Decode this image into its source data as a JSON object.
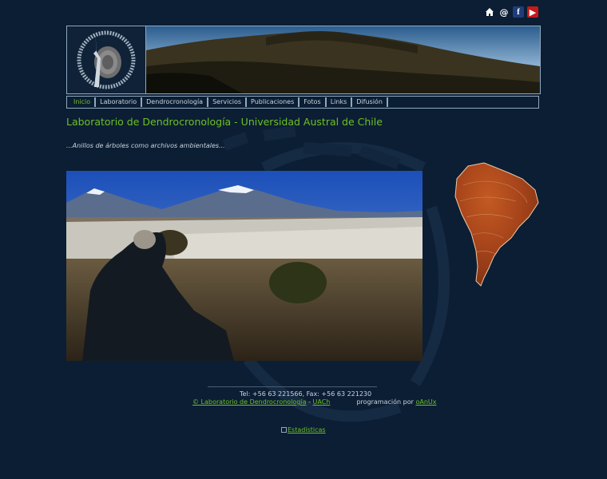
{
  "top_icons": [
    "home-icon",
    "at-icon",
    "facebook-icon",
    "youtube-icon"
  ],
  "logo": {
    "ring_text": "LABORATORIO DE DENDROCRONOLOGIA · UNIVERSIDAD AUSTRAL DE CHILE"
  },
  "nav": {
    "items": [
      {
        "label": "Inicio",
        "active": true
      },
      {
        "label": "Laboratorio",
        "active": false
      },
      {
        "label": "Dendrocronología",
        "active": false
      },
      {
        "label": "Servicios",
        "active": false
      },
      {
        "label": "Publicaciones",
        "active": false
      },
      {
        "label": "Fotos",
        "active": false
      },
      {
        "label": "Links",
        "active": false
      },
      {
        "label": "Difusión",
        "active": false
      }
    ]
  },
  "main": {
    "title": "Laboratorio de Dendrocronología - Universidad Austral de Chile",
    "tagline": "...Anillos de árboles como archivos ambientales..."
  },
  "footer": {
    "tel": "Tel: +56 63 221566, Fax: +56 63 221230",
    "copyright_link": "© Laboratorio de Dendrocronología",
    "separator": "-",
    "uach_link": "UACh",
    "programming_label": "programación por",
    "author_link": "oAnUx",
    "stats_link": "Estadísticas"
  },
  "colors": {
    "background": "#0c1e33",
    "accent_green": "#6cc024",
    "border": "#8fa8c0"
  }
}
